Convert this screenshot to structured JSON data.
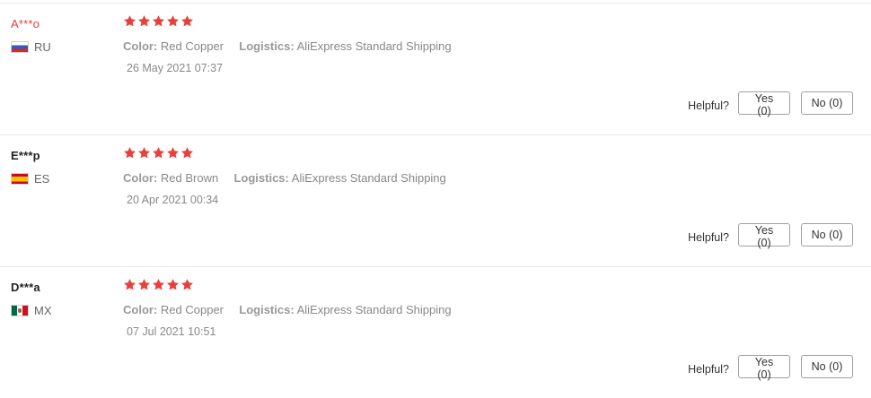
{
  "reviews": [
    {
      "user": "A***o",
      "country": "RU",
      "rating": 5,
      "color_label": "Color:",
      "color_value": "Red Copper",
      "logistics_label": "Logistics:",
      "logistics_value": "AliExpress Standard Shipping",
      "date": "26 May 2021 07:37",
      "helpful_label": "Helpful?",
      "yes_label": "Yes (0)",
      "no_label": "No (0)"
    },
    {
      "user": "E***p",
      "country": "ES",
      "rating": 5,
      "color_label": "Color:",
      "color_value": "Red Brown",
      "logistics_label": "Logistics:",
      "logistics_value": "AliExpress Standard Shipping",
      "date": "20 Apr 2021 00:34",
      "helpful_label": "Helpful?",
      "yes_label": "Yes (0)",
      "no_label": "No (0)"
    },
    {
      "user": "D***a",
      "country": "MX",
      "rating": 5,
      "color_label": "Color:",
      "color_value": "Red Copper",
      "logistics_label": "Logistics:",
      "logistics_value": "AliExpress Standard Shipping",
      "date": "07 Jul 2021 10:51",
      "helpful_label": "Helpful?",
      "yes_label": "Yes (0)",
      "no_label": "No (0)"
    }
  ],
  "colors": {
    "star": "#e8403c",
    "highlight_name": "#e8403c"
  },
  "icons": {
    "star": "star-icon",
    "flag_ru": "russia-flag-icon",
    "flag_es": "spain-flag-icon",
    "flag_mx": "mexico-flag-icon"
  }
}
